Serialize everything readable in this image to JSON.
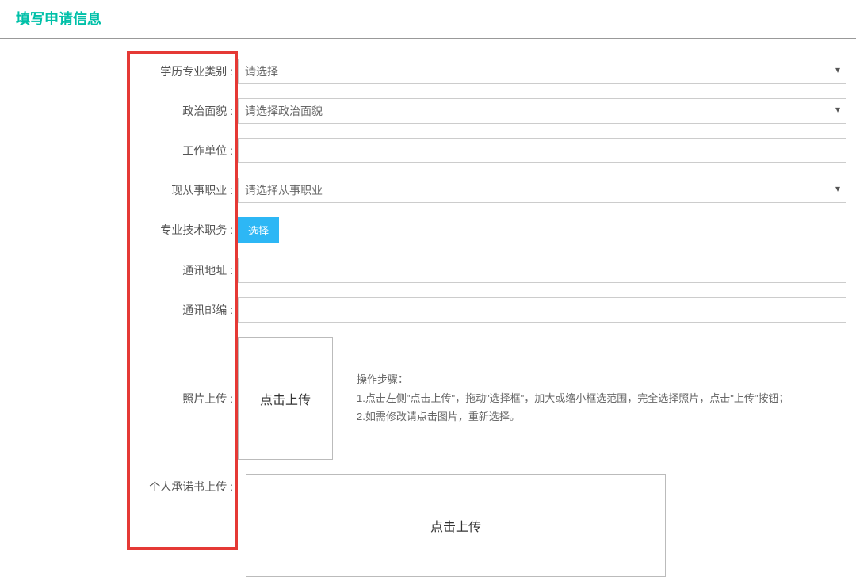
{
  "header": {
    "title": "填写申请信息"
  },
  "form": {
    "eduCategory": {
      "label": "学历专业类别 :",
      "placeholder": "请选择"
    },
    "politicalStatus": {
      "label": "政治面貌 :",
      "placeholder": "请选择政治面貌"
    },
    "workUnit": {
      "label": "工作单位 :",
      "value": ""
    },
    "currentJob": {
      "label": "现从事职业 :",
      "placeholder": "请选择从事职业"
    },
    "techTitle": {
      "label": "专业技术职务 :",
      "buttonText": "选择"
    },
    "address": {
      "label": "通讯地址 :",
      "value": ""
    },
    "postcode": {
      "label": "通讯邮编 :",
      "value": ""
    },
    "photoUpload": {
      "label": "照片上传 :",
      "buttonText": "点击上传",
      "hintTitle": "操作步骤：",
      "hintLine1": "1.点击左侧\"点击上传\"，拖动\"选择框\"，加大或缩小框选范围，完全选择照片，点击\"上传\"按钮；",
      "hintLine2": "2.如需修改请点击图片，重新选择。"
    },
    "commitmentUpload": {
      "label": "个人承诺书上传 :",
      "buttonText": "点击上传"
    }
  }
}
